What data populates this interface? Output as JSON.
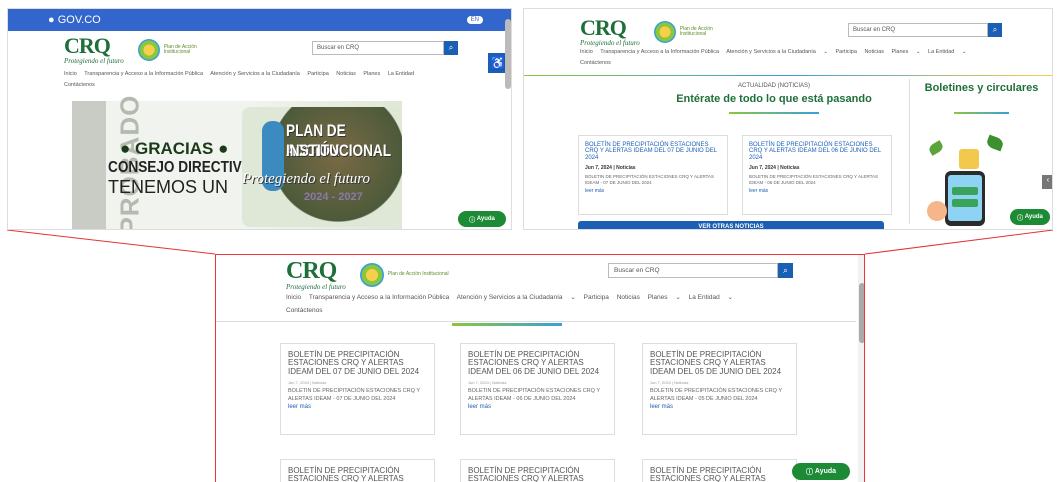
{
  "shot1": {
    "gov_label": "GOV.CO",
    "lang_label": "EN",
    "logo": {
      "name": "CRQ",
      "tagline": "Protegiendo el futuro",
      "plan_text": "Plan de Acción Institucional"
    },
    "search_placeholder": "Buscar en CRQ",
    "nav": [
      "Inicio",
      "Transparencia y Acceso a la Información Pública",
      "Atención y Servicios a la Ciudadanía",
      "Participa",
      "Noticias",
      "Planes",
      "La Entidad"
    ],
    "nav_second_line": "Contáctenos",
    "banner": {
      "side_text": "APROBADO",
      "line1": "GRACIAS",
      "line2": "CONSEJO DIRECTIVO",
      "line3": "TENEMOS UN",
      "plan1": "PLAN DE ACCIÓN",
      "plan2": "INSTITUCIONAL",
      "script": "Protegiendo el futuro",
      "years": "2024 - 2027"
    },
    "help_label": "Ayuda"
  },
  "shot2": {
    "search_placeholder": "Buscar en CRQ",
    "nav": [
      "Inicio",
      "Transparencia y Acceso a la Información Pública",
      "Atención y Servicios a la Ciudadanía",
      "Participa",
      "Noticias",
      "Planes",
      "La Entidad"
    ],
    "nav_second_line": "Contáctenos",
    "section_kicker": "ACTUALIDAD (NOTICIAS)",
    "section_title": "Entérate de todo lo que está pasando",
    "bulletins_title": "Boletines y circulares",
    "cards": [
      {
        "title": "BOLETÍN DE PRECIPITACIÓN ESTACIONES CRQ Y ALERTAS IDEAM DEL 07 DE JUNIO DEL 2024",
        "meta": "Jun 7, 2024 | Noticias",
        "body": "BOLETIN DE PRECIPITACIÓN ESTACIONES CRQ Y ALERTAS IDEAM - 07 DE JUNIO DEL 2024",
        "link": "leer más"
      },
      {
        "title": "BOLETÍN DE PRECIPITACIÓN ESTACIONES CRQ Y ALERTAS IDEAM DEL 06 DE JUNIO DEL 2024",
        "meta": "Jun 7, 2024 | Noticias",
        "body": "BOLETIN DE PRECIPITACIÓN ESTACIONES CRQ Y ALERTAS IDEAM - 06 DE JUNIO DEL 2024",
        "link": "leer más"
      }
    ],
    "more_button": "VER OTRAS NOTICIAS",
    "help_label": "Ayuda"
  },
  "shot3": {
    "search_placeholder": "Buscar en CRQ",
    "nav": [
      "Inicio",
      "Transparencia y Acceso a la Información Pública",
      "Atención y Servicios a la Ciudadanía",
      "Participa",
      "Noticias",
      "Planes",
      "La Entidad"
    ],
    "nav_second_line": "Contáctenos",
    "cards": [
      {
        "title": "BOLETÍN DE PRECIPITACIÓN ESTACIONES CRQ Y ALERTAS IDEAM DEL 07 DE JUNIO DEL 2024",
        "meta": "Jun 7, 2024 | Noticias",
        "body": "BOLETIN DE PRECIPITACIÓN ESTACIONES CRQ Y ALERTAS IDEAM - 07 DE JUNIO DEL 2024",
        "link": "leer más"
      },
      {
        "title": "BOLETÍN DE PRECIPITACIÓN ESTACIONES CRQ Y ALERTAS IDEAM DEL 06 DE JUNIO DEL 2024",
        "meta": "Jun 7, 2024 | Noticias",
        "body": "BOLETIN DE PRECIPITACIÓN ESTACIONES CRQ Y ALERTAS IDEAM - 06 DE JUNIO DEL 2024",
        "link": "leer más"
      },
      {
        "title": "BOLETÍN DE PRECIPITACIÓN ESTACIONES CRQ Y ALERTAS IDEAM DEL 05 DE JUNIO DEL 2024",
        "meta": "Jun 7, 2024 | Noticias",
        "body": "BOLETIN DE PRECIPITACIÓN ESTACIONES CRQ Y ALERTAS IDEAM - 05 DE JUNIO DEL 2024",
        "link": "leer más"
      }
    ],
    "cards_row2": [
      "BOLETÍN DE PRECIPITACIÓN ESTACIONES CRQ Y ALERTAS",
      "BOLETÍN DE PRECIPITACIÓN ESTACIONES CRQ Y ALERTAS",
      "BOLETÍN DE PRECIPITACIÓN ESTACIONES CRQ Y ALERTAS"
    ],
    "help_label": "Ayuda"
  },
  "colors": {
    "gov_blue": "#3366cc",
    "brand_green": "#1f6f3a",
    "link_blue": "#1a5fb4",
    "help_green": "#1d8a35",
    "connector_red": "#e33333"
  }
}
